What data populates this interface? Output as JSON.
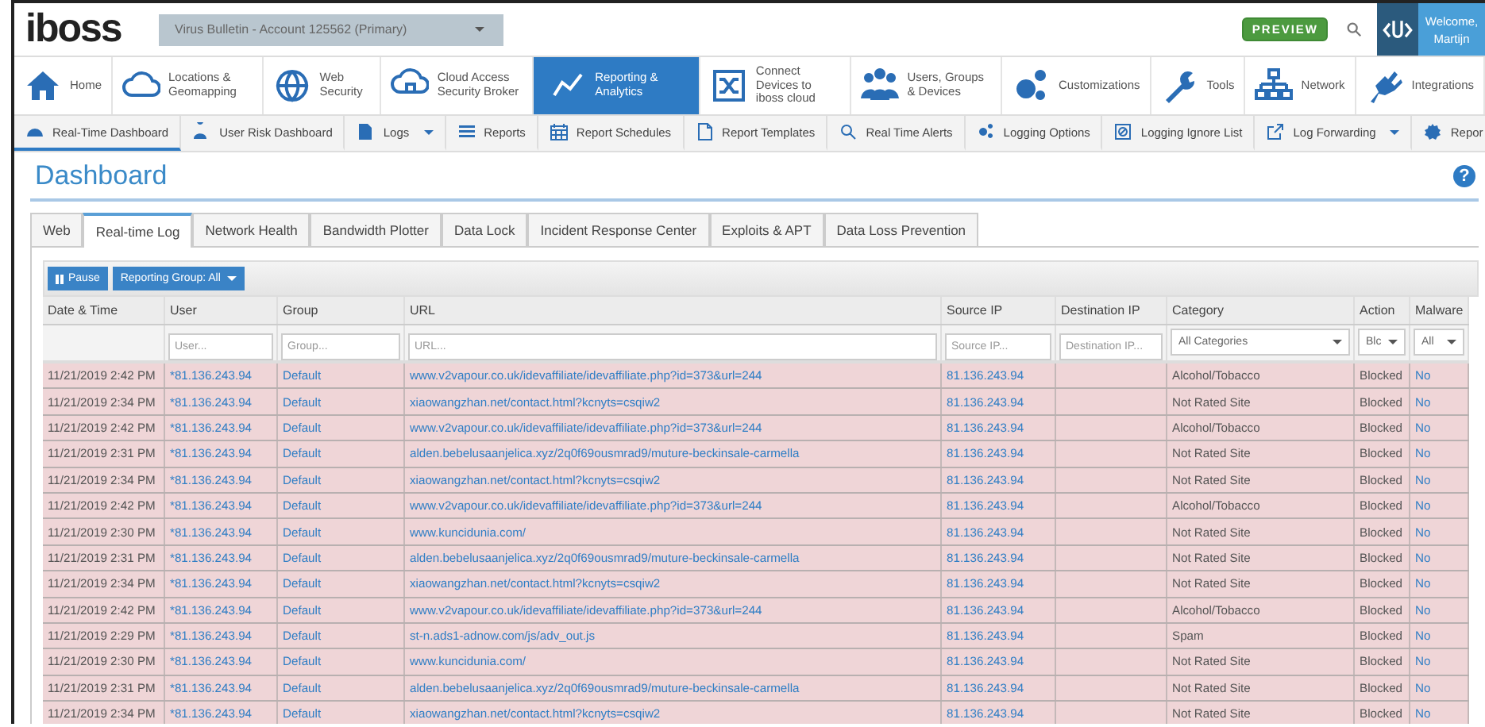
{
  "header": {
    "logo": "iboss",
    "account": "Virus Bulletin - Account 125562 (Primary)",
    "badge": "PREVIEW",
    "welcome": "Welcome,",
    "user": "Martijn"
  },
  "nav": [
    {
      "label": "Home",
      "selected": false
    },
    {
      "label": "Locations & Geomapping",
      "selected": false
    },
    {
      "label": "Web Security",
      "selected": false
    },
    {
      "label": "Cloud Access Security Broker",
      "selected": false
    },
    {
      "label": "Reporting & Analytics",
      "selected": true
    },
    {
      "label": "Connect Devices to iboss cloud",
      "selected": false
    },
    {
      "label": "Users, Groups & Devices",
      "selected": false
    },
    {
      "label": "Customizations",
      "selected": false
    },
    {
      "label": "Tools",
      "selected": false
    },
    {
      "label": "Network",
      "selected": false
    },
    {
      "label": "Integrations",
      "selected": false
    }
  ],
  "subnav": [
    {
      "label": "Real-Time Dashboard",
      "selected": true,
      "menu": false
    },
    {
      "label": "User Risk Dashboard",
      "selected": false,
      "menu": false
    },
    {
      "label": "Logs",
      "selected": false,
      "menu": true
    },
    {
      "label": "Reports",
      "selected": false,
      "menu": false
    },
    {
      "label": "Report Schedules",
      "selected": false,
      "menu": false
    },
    {
      "label": "Report Templates",
      "selected": false,
      "menu": false
    },
    {
      "label": "Real Time Alerts",
      "selected": false,
      "menu": false
    },
    {
      "label": "Logging Options",
      "selected": false,
      "menu": false
    },
    {
      "label": "Logging Ignore List",
      "selected": false,
      "menu": false
    },
    {
      "label": "Log Forwarding",
      "selected": false,
      "menu": true
    },
    {
      "label": "Repor",
      "selected": false,
      "menu": false
    }
  ],
  "page": {
    "title": "Dashboard",
    "help": "?"
  },
  "tabs": [
    {
      "label": "Web",
      "selected": false
    },
    {
      "label": "Real-time Log",
      "selected": true
    },
    {
      "label": "Network Health",
      "selected": false
    },
    {
      "label": "Bandwidth Plotter",
      "selected": false
    },
    {
      "label": "Data Lock",
      "selected": false
    },
    {
      "label": "Incident Response Center",
      "selected": false
    },
    {
      "label": "Exploits & APT",
      "selected": false
    },
    {
      "label": "Data Loss Prevention",
      "selected": false
    }
  ],
  "toolbar": {
    "pause": "Pause",
    "group": "Reporting Group: All"
  },
  "table": {
    "columns": [
      "Date & Time",
      "User",
      "Group",
      "URL",
      "Source IP",
      "Destination IP",
      "Category",
      "Action",
      "Malware"
    ],
    "filters": [
      {
        "kind": "none"
      },
      {
        "kind": "text",
        "placeholder": "User..."
      },
      {
        "kind": "text",
        "placeholder": "Group..."
      },
      {
        "kind": "text",
        "placeholder": "URL..."
      },
      {
        "kind": "text",
        "placeholder": "Source IP..."
      },
      {
        "kind": "text",
        "placeholder": "Destination IP..."
      },
      {
        "kind": "select",
        "value": "All Categories"
      },
      {
        "kind": "select",
        "value": "Blc"
      },
      {
        "kind": "select",
        "value": "All"
      }
    ],
    "rows": [
      [
        "11/21/2019 2:42 PM",
        "*81.136.243.94",
        "Default",
        "www.v2vapour.co.uk/idevaffiliate/idevaffiliate.php?id=373&url=244",
        "81.136.243.94",
        "",
        "Alcohol/Tobacco",
        "Blocked",
        "No"
      ],
      [
        "11/21/2019 2:34 PM",
        "*81.136.243.94",
        "Default",
        "xiaowangzhan.net/contact.html?kcnyts=csqiw2",
        "81.136.243.94",
        "",
        "Not Rated Site",
        "Blocked",
        "No"
      ],
      [
        "11/21/2019 2:42 PM",
        "*81.136.243.94",
        "Default",
        "www.v2vapour.co.uk/idevaffiliate/idevaffiliate.php?id=373&url=244",
        "81.136.243.94",
        "",
        "Alcohol/Tobacco",
        "Blocked",
        "No"
      ],
      [
        "11/21/2019 2:31 PM",
        "*81.136.243.94",
        "Default",
        "alden.bebelusaanjelica.xyz/2q0f69ousmrad9/muture-beckinsale-carmella",
        "81.136.243.94",
        "",
        "Not Rated Site",
        "Blocked",
        "No"
      ],
      [
        "11/21/2019 2:34 PM",
        "*81.136.243.94",
        "Default",
        "xiaowangzhan.net/contact.html?kcnyts=csqiw2",
        "81.136.243.94",
        "",
        "Not Rated Site",
        "Blocked",
        "No"
      ],
      [
        "11/21/2019 2:42 PM",
        "*81.136.243.94",
        "Default",
        "www.v2vapour.co.uk/idevaffiliate/idevaffiliate.php?id=373&url=244",
        "81.136.243.94",
        "",
        "Alcohol/Tobacco",
        "Blocked",
        "No"
      ],
      [
        "11/21/2019 2:30 PM",
        "*81.136.243.94",
        "Default",
        "www.kuncidunia.com/",
        "81.136.243.94",
        "",
        "Not Rated Site",
        "Blocked",
        "No"
      ],
      [
        "11/21/2019 2:31 PM",
        "*81.136.243.94",
        "Default",
        "alden.bebelusaanjelica.xyz/2q0f69ousmrad9/muture-beckinsale-carmella",
        "81.136.243.94",
        "",
        "Not Rated Site",
        "Blocked",
        "No"
      ],
      [
        "11/21/2019 2:34 PM",
        "*81.136.243.94",
        "Default",
        "xiaowangzhan.net/contact.html?kcnyts=csqiw2",
        "81.136.243.94",
        "",
        "Not Rated Site",
        "Blocked",
        "No"
      ],
      [
        "11/21/2019 2:42 PM",
        "*81.136.243.94",
        "Default",
        "www.v2vapour.co.uk/idevaffiliate/idevaffiliate.php?id=373&url=244",
        "81.136.243.94",
        "",
        "Alcohol/Tobacco",
        "Blocked",
        "No"
      ],
      [
        "11/21/2019 2:29 PM",
        "*81.136.243.94",
        "Default",
        "st-n.ads1-adnow.com/js/adv_out.js",
        "81.136.243.94",
        "",
        "Spam",
        "Blocked",
        "No"
      ],
      [
        "11/21/2019 2:30 PM",
        "*81.136.243.94",
        "Default",
        "www.kuncidunia.com/",
        "81.136.243.94",
        "",
        "Not Rated Site",
        "Blocked",
        "No"
      ],
      [
        "11/21/2019 2:31 PM",
        "*81.136.243.94",
        "Default",
        "alden.bebelusaanjelica.xyz/2q0f69ousmrad9/muture-beckinsale-carmella",
        "81.136.243.94",
        "",
        "Not Rated Site",
        "Blocked",
        "No"
      ],
      [
        "11/21/2019 2:34 PM",
        "*81.136.243.94",
        "Default",
        "xiaowangzhan.net/contact.html?kcnyts=csqiw2",
        "81.136.243.94",
        "",
        "Not Rated Site",
        "Blocked",
        "No"
      ]
    ]
  }
}
